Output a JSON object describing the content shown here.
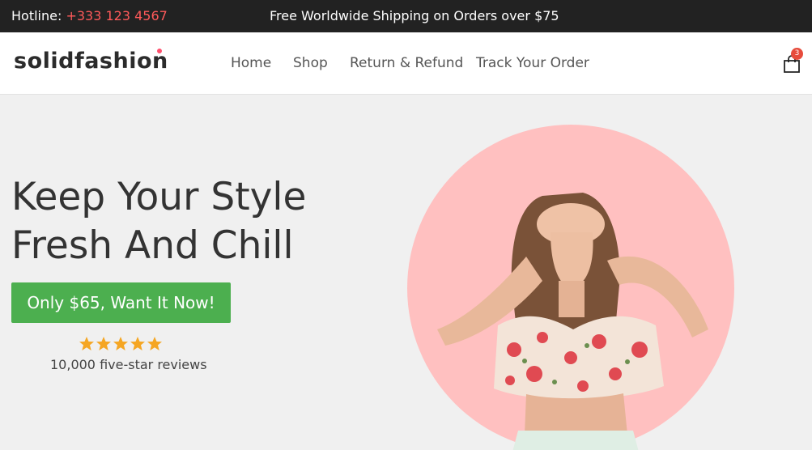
{
  "topbar": {
    "hotline_label": "Hotline:",
    "hotline_number": "+333 123 4567",
    "shipping_text": "Free Worldwide Shipping on Orders over $75"
  },
  "header": {
    "logo_text": "solidfashion",
    "nav": [
      "Home",
      "Shop",
      "Return & Refund",
      "Track Your Order"
    ],
    "cart_count": "3",
    "cart_icon": "shopping-bag-icon"
  },
  "hero": {
    "headline_line1": "Keep Your Style",
    "headline_line2": "Fresh And Chill",
    "cta_label": "Only $65, Want It Now!",
    "rating_stars": 5,
    "reviews_text": "10,000 five-star reviews",
    "image": "woman-covering-eyes-floral-crop-top"
  },
  "colors": {
    "topbar_bg": "#222222",
    "hotline_accent": "#ff5a5a",
    "cta_green": "#4caf4f",
    "circle_pink": "#ffc0c0",
    "star_orange": "#f5a623",
    "badge_red": "#e74c3c"
  }
}
